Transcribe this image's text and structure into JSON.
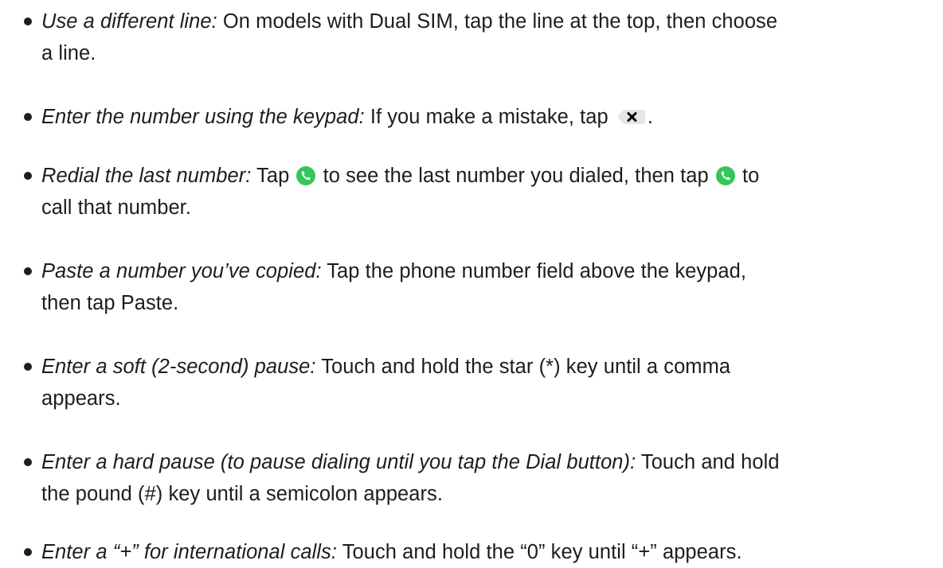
{
  "tips": [
    {
      "term": "Use a different line:",
      "line1": " On models with Dual SIM, tap the line at the top, then choose",
      "line2": "a line."
    },
    {
      "term": "Enter the number using the keypad:",
      "text": " If you make a mistake, tap",
      "after": ".",
      "icon": "delete-key-icon"
    },
    {
      "term": "Redial the last number:",
      "part1": " Tap",
      "part2": "to see the last number you dialed, then tap",
      "part3": "to",
      "line2": "call that number.",
      "icon": "call-button-icon",
      "icon_color": "#34c759"
    },
    {
      "term": "Paste a number you’ve copied:",
      "line1": " Tap the phone number field above the keypad,",
      "line2": "then tap Paste."
    },
    {
      "term": "Enter a soft (2-second) pause:",
      "line1": " Touch and hold the star (*) key until a comma",
      "line2": "appears."
    },
    {
      "term": "Enter a hard pause (to pause dialing until you tap the Dial button):",
      "line1": " Touch and hold",
      "line2": "the pound (#) key until a semicolon appears."
    },
    {
      "term": "Enter a “+” for international calls:",
      "text": " Touch and hold the “0” key until “+” appears."
    }
  ]
}
